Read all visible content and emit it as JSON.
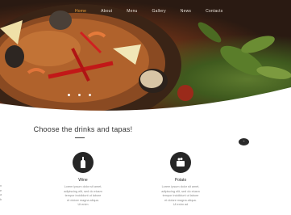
{
  "nav": {
    "items": [
      {
        "label": "Home",
        "active": true
      },
      {
        "label": "About",
        "active": false
      },
      {
        "label": "Menu",
        "active": false
      },
      {
        "label": "Gallery",
        "active": false
      },
      {
        "label": "News",
        "active": false
      },
      {
        "label": "Contacts",
        "active": false
      }
    ]
  },
  "hero": {
    "slides": 3,
    "active_slide": 1
  },
  "section": {
    "title": "Choose the drinks and tapas!"
  },
  "features": [
    {
      "icon": "wine-bottle-icon",
      "title": "Wine",
      "text": [
        "Lorem ipsum dolor sit amet,",
        "adipiscing elit, sed do eiusm",
        "tempor incididunt ut labore",
        "et dolore magna aliqua.",
        "Ut enim"
      ]
    },
    {
      "icon": "potato-pot-icon",
      "title": "Potato",
      "text": [
        "Lorem ipsum dolor sit amet,",
        "adipiscing elit, sed do eiusm",
        "tempor incididunt ut labore",
        "et dolore magna aliqua.",
        "Ut enim ad"
      ]
    }
  ],
  "edge_text": [
    "n",
    "e",
    "a",
    "b"
  ],
  "colors": {
    "accent": "#f0a33a",
    "dark": "#262626"
  }
}
